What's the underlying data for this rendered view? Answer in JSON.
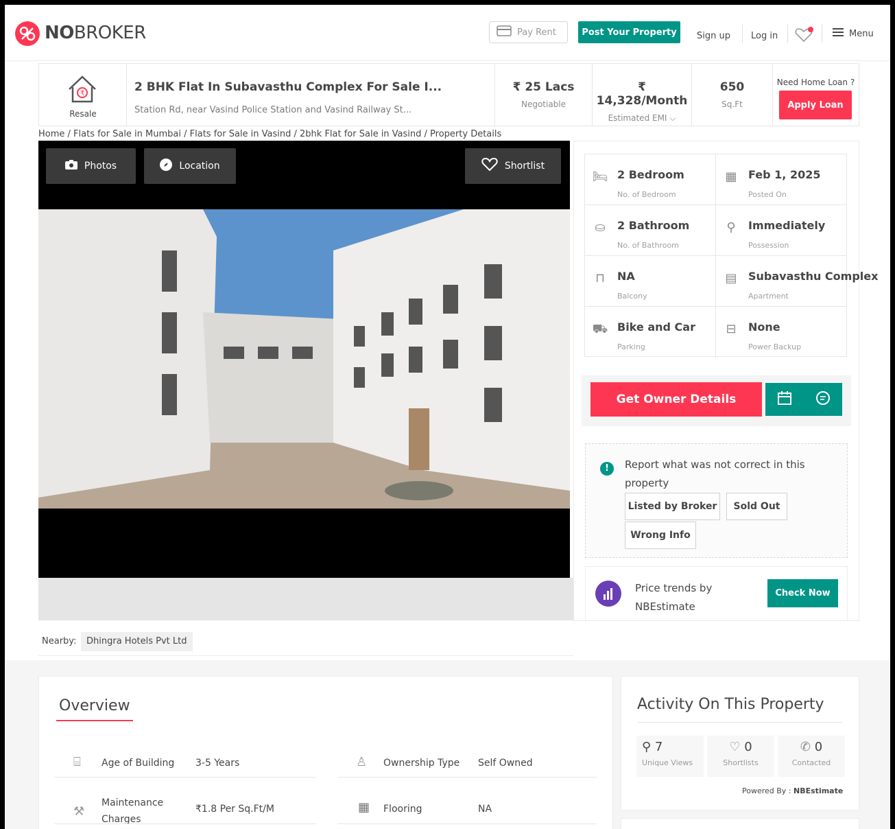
{
  "nav": {
    "logo_bold": "NO",
    "logo_rest": "BROKER",
    "pay_rent": "Pay Rent",
    "post_property": "Post Your Property",
    "sign_up": "Sign up",
    "log_in": "Log in",
    "menu": "Menu"
  },
  "header": {
    "tag": "Resale",
    "title": "2 BHK Flat In Subavasthu Complex For Sale I...",
    "address": "Station Rd, near Vasind Police Station and Vasind Railway St...",
    "price": "₹ 25 Lacs",
    "price_sub": "Negotiable",
    "emi": "₹ 14,328/Month",
    "emi_sub": "Estimated EMI",
    "area": "650",
    "area_sub": "Sq.Ft",
    "loan_q": "Need Home Loan ?",
    "apply_loan": "Apply Loan"
  },
  "breadcrumb": "Home / Flats for Sale in Mumbai / Flats for Sale in Vasind / 2bhk Flat for Sale in Vasind / Property Details",
  "gallery": {
    "photos": "Photos",
    "location": "Location",
    "shortlist": "Shortlist"
  },
  "details": [
    {
      "value": "2 Bedroom",
      "label": "No. of Bedroom",
      "icon": "bed-icon"
    },
    {
      "value": "Feb 1, 2025",
      "label": "Posted On",
      "icon": "calendar-icon"
    },
    {
      "value": "2 Bathroom",
      "label": "No. of Bathroom",
      "icon": "bathtub-icon"
    },
    {
      "value": "Immediately",
      "label": "Possession",
      "icon": "key-icon"
    },
    {
      "value": "NA",
      "label": "Balcony",
      "icon": "balcony-icon"
    },
    {
      "value": "Subavasthu Complex",
      "label": "Apartment",
      "icon": "building-icon"
    },
    {
      "value": "Bike and Car",
      "label": "Parking",
      "icon": "car-icon"
    },
    {
      "value": "None",
      "label": "Power Backup",
      "icon": "battery-icon"
    }
  ],
  "owner": {
    "button": "Get Owner Details"
  },
  "report": {
    "text": "Report what was not correct in this property",
    "options": [
      "Listed by Broker",
      "Sold Out",
      "Wrong Info"
    ]
  },
  "trends": {
    "line1": "Price trends by",
    "line2": "NBEstimate",
    "button": "Check Now"
  },
  "nearby": {
    "label": "Nearby:",
    "place": "Dhingra Hotels Pvt Ltd"
  },
  "overview": {
    "title": "Overview",
    "rows": [
      {
        "label": "Age of Building",
        "value": "3-5 Years"
      },
      {
        "label": "Ownership Type",
        "value": "Self Owned"
      },
      {
        "label": "Maintenance Charges",
        "value": "₹1.8 Per Sq.Ft/M"
      },
      {
        "label": "Flooring",
        "value": "NA"
      }
    ]
  },
  "activity": {
    "title": "Activity On This Property",
    "stats": [
      {
        "count": "7",
        "label": "Unique Views"
      },
      {
        "count": "0",
        "label": "Shortlists"
      },
      {
        "count": "0",
        "label": "Contacted"
      }
    ],
    "powered_prefix": "Powered By :",
    "powered_name": "NBEstimate"
  },
  "colors": {
    "brand_red": "#fd3752",
    "teal": "#009587",
    "text": "#464646"
  }
}
